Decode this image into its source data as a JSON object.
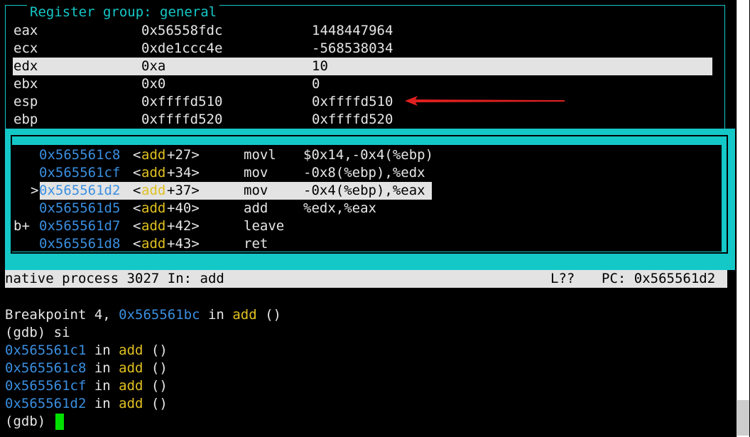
{
  "register_panel": {
    "title": "Register group: general",
    "rows": [
      {
        "name": "eax",
        "hex": "0x56558fdc",
        "natural": "1448447964",
        "selected": false
      },
      {
        "name": "ecx",
        "hex": "0xde1ccc4e",
        "natural": "-568538034",
        "selected": false
      },
      {
        "name": "edx",
        "hex": "0xa",
        "natural": "10",
        "selected": true
      },
      {
        "name": "ebx",
        "hex": "0x0",
        "natural": "0",
        "selected": false
      },
      {
        "name": "esp",
        "hex": "0xffffd510",
        "natural": "0xffffd510",
        "selected": false
      },
      {
        "name": "ebp",
        "hex": "0xffffd520",
        "natural": "0xffffd520",
        "selected": false
      }
    ]
  },
  "asm_panel": {
    "rows": [
      {
        "marker": "",
        "addr": "0x565561c8",
        "lt": "<",
        "func": "add",
        "off": "+27>",
        "op": "movl",
        "args": "$0x14,-0x4(%ebp)"
      },
      {
        "marker": "",
        "addr": "0x565561cf",
        "lt": "<",
        "func": "add",
        "off": "+34>",
        "op": "mov",
        "args": "-0x8(%ebp),%edx"
      },
      {
        "marker": ">",
        "addr": "0x565561d2",
        "lt": "<",
        "func": "add",
        "off": "+37>",
        "op": "mov",
        "args": "-0x4(%ebp),%eax"
      },
      {
        "marker": "",
        "addr": "0x565561d5",
        "lt": "<",
        "func": "add",
        "off": "+40>",
        "op": "add",
        "args": "%edx,%eax"
      },
      {
        "marker": "b+",
        "addr": "0x565561d7",
        "lt": "<",
        "func": "add",
        "off": "+42>",
        "op": "leave",
        "args": ""
      },
      {
        "marker": "",
        "addr": "0x565561d8",
        "lt": "<",
        "func": "add",
        "off": "+43>",
        "op": "ret",
        "args": ""
      }
    ]
  },
  "status_bar": {
    "process": "native process 3027 In: add",
    "line": "L??",
    "pc": "PC: 0x565561d2"
  },
  "console": {
    "breakpoint_prefix": "Breakpoint 4, ",
    "breakpoint_addr": "0x565561bc",
    "breakpoint_in": " in ",
    "breakpoint_func": "add",
    "breakpoint_suffix": " ()",
    "command": "(gdb) si",
    "lines": [
      {
        "addr": "0x565561c1",
        "in": " in ",
        "func": "add",
        "suffix": " ()"
      },
      {
        "addr": "0x565561c8",
        "in": " in ",
        "func": "add",
        "suffix": " ()"
      },
      {
        "addr": "0x565561cf",
        "in": " in ",
        "func": "add",
        "suffix": " ()"
      },
      {
        "addr": "0x565561d2",
        "in": " in ",
        "func": "add",
        "suffix": " ()"
      }
    ],
    "prompt": "(gdb) "
  },
  "colors": {
    "frame": "#14c8c8",
    "address": "#3a8fe0",
    "function": "#e0c020",
    "cursor": "#00e000",
    "arrow": "#e02020"
  },
  "icons": {
    "arrow": "red-arrow-icon"
  }
}
